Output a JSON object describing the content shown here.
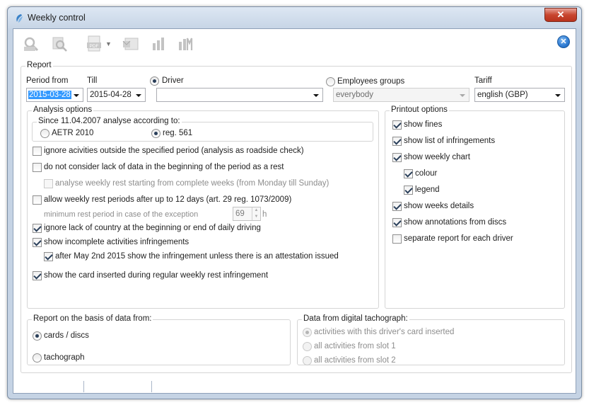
{
  "window": {
    "title": "Weekly control"
  },
  "toolbar": {
    "icons": [
      "search-report-icon",
      "preview-icon",
      "pdf-icon",
      "dropdown-arrow-icon",
      "email-icon",
      "chart-icon",
      "chart-m-icon"
    ],
    "pdf_label": "PDF"
  },
  "report": {
    "title": "Report",
    "period_from_label": "Period from",
    "period_from_value": "2015-03-28",
    "till_label": "Till",
    "till_value": "2015-04-28",
    "driver_label": "Driver",
    "driver_value": "",
    "employees_label": "Employees groups",
    "employees_value": "everybody",
    "tariff_label": "Tariff",
    "tariff_value": "english (GBP)"
  },
  "analysis": {
    "title": "Analysis options",
    "since_title": "Since 11.04.2007 analyse according to:",
    "aetr_label": "AETR 2010",
    "reg561_label": "reg. 561",
    "options": {
      "ignore_outside": "ignore acivities outside the specified period (analysis as roadside check)",
      "no_lack_data": "do not consider lack of data in the beginning of the period as a rest",
      "analyse_weekly": "analyse weekly rest starting from complete weeks (from Monday till Sunday)",
      "allow_12_days": "allow weekly rest periods after up to 12 days (art. 29 reg. 1073/2009)",
      "min_rest_label": "minimum rest period in case of the exception",
      "min_rest_value": "69",
      "min_rest_unit": "h",
      "ignore_country": "ignore lack of country at the beginning or end of daily driving",
      "show_incomplete": "show incomplete activities infringements",
      "after_may": "after May 2nd 2015 show the infringement unless there is an attestation issued",
      "show_card": "show the card inserted during regular weekly rest infringement"
    }
  },
  "printout": {
    "title": "Printout options",
    "show_fines": "show fines",
    "show_list": "show list of infringements",
    "show_weekly_chart": "show weekly chart",
    "colour": "colour",
    "legend": "legend",
    "show_weeks_details": "show weeks details",
    "show_annotations": "show annotations from discs",
    "separate_report": "separate report for each driver"
  },
  "basis": {
    "title": "Report on the basis of data from:",
    "cards": "cards / discs",
    "tachograph": "tachograph"
  },
  "digital": {
    "title": "Data from digital tachograph:",
    "card_inserted": "activities with this driver's card inserted",
    "slot1": "all activities from slot 1",
    "slot2": "all activities from slot 2"
  }
}
